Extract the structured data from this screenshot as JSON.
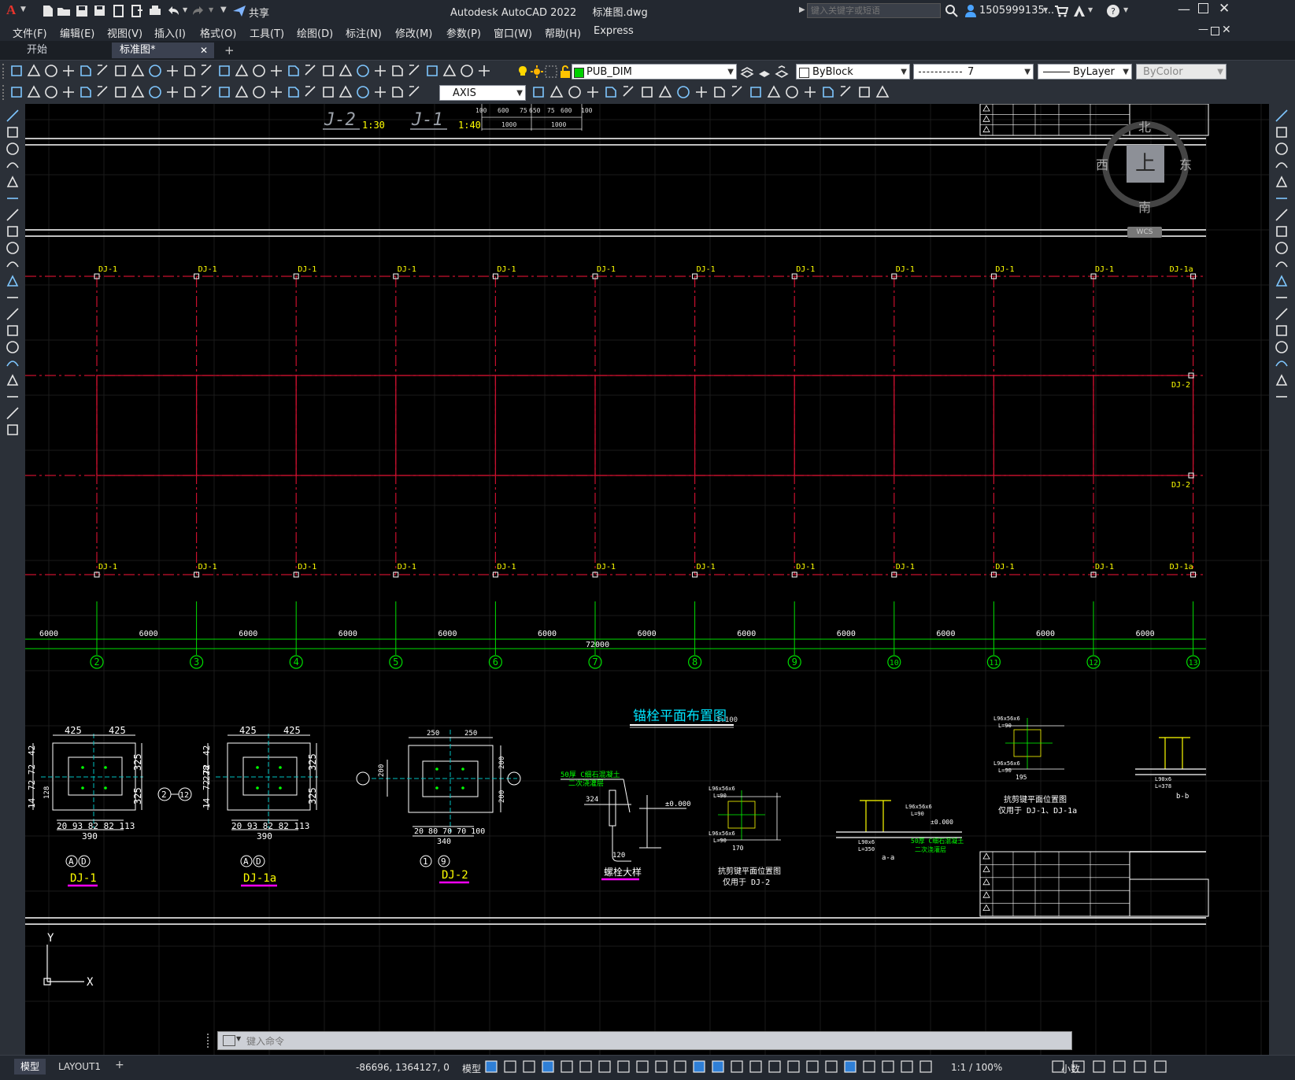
{
  "titlebar": {
    "app_title": "Autodesk AutoCAD 2022",
    "file_name": "标准图.dwg",
    "share_label": "共享",
    "search_placeholder": "键入关键字或短语",
    "user_name": "1505999135...",
    "logo_letter": "A"
  },
  "menu": {
    "items": [
      "文件(F)",
      "编辑(E)",
      "视图(V)",
      "插入(I)",
      "格式(O)",
      "工具(T)",
      "绘图(D)",
      "标注(N)",
      "修改(M)",
      "参数(P)",
      "窗口(W)",
      "帮助(H)",
      "Express"
    ]
  },
  "tabs": {
    "start_label": "开始",
    "active_label": "标准图*",
    "close_glyph": "✕",
    "add_glyph": "+"
  },
  "toolbar": {
    "layer_name": "PUB_DIM",
    "color_value": "ByBlock",
    "linetype_value": "7",
    "lineweight_value": "ByLayer",
    "plotstyle_value": "ByColor",
    "dimstyle_value": "AXIS"
  },
  "viewcube": {
    "north": "北",
    "south": "南",
    "east": "东",
    "west": "西",
    "face": "上",
    "wcs_label": "WCS"
  },
  "drawing": {
    "top_labels": {
      "j2": "J-2",
      "j2_scale": "1:30",
      "j1": "J-1",
      "j1_scale": "1:40"
    },
    "top_dims": [
      "100",
      "600",
      "75",
      "650",
      "75",
      "600",
      "100",
      "1000",
      "1000"
    ],
    "dj_tags_top": [
      "DJ-1",
      "DJ-1",
      "DJ-1",
      "DJ-1",
      "DJ-1",
      "DJ-1",
      "DJ-1",
      "DJ-1",
      "DJ-1",
      "DJ-1",
      "DJ-1",
      "DJ-1a"
    ],
    "dj_tags_bottom": [
      "DJ-1",
      "DJ-1",
      "DJ-1",
      "DJ-1",
      "DJ-1",
      "DJ-1",
      "DJ-1",
      "DJ-1",
      "DJ-1",
      "DJ-1",
      "DJ-1",
      "DJ-1a"
    ],
    "dj_tags_side": [
      "DJ-2",
      "DJ-2"
    ],
    "span_dims": [
      "6000",
      "6000",
      "6000",
      "6000",
      "6000",
      "6000",
      "6000",
      "6000",
      "6000",
      "6000",
      "6000",
      "6000"
    ],
    "total_dim": "72000",
    "axis_numbers": [
      "2",
      "3",
      "4",
      "5",
      "6",
      "7",
      "8",
      "9",
      "10",
      "11",
      "12",
      "13"
    ],
    "plan_title": "锚栓平面布置图",
    "plan_scale": "1:100",
    "details": {
      "dj1_label": "DJ-1",
      "dj1a_label": "DJ-1a",
      "dj2_label": "DJ-2",
      "bolt_label": "螺栓大样",
      "dim_425": "425",
      "dim_325": "325",
      "dim_390": "390",
      "dim_row": "20 93 82 82 113",
      "dim_left1": "42",
      "dim_left2": "72 72",
      "dim_left3": "128",
      "dim_left4": "14",
      "dim_228": "228",
      "axis_ad_a": "A",
      "axis_ad_d": "D",
      "axis_2": "2",
      "axis_12": "12",
      "dim_250": "250",
      "dim_200": "200",
      "dim_340": "340",
      "dim_row2": "20 80 70 70 100",
      "axis_1": "1",
      "axis_9": "9",
      "grout_note": "50厚 C细石混凝土",
      "grout_note2": "二次浇灌层",
      "dim_324": "324",
      "dim_120": "120",
      "elev": "±0.000",
      "shear_key_title": "抗剪键平面位置图",
      "shear_key_sub": "仅用于 DJ-2",
      "shear_key_title2": "抗剪键平面位置图",
      "shear_key_sub2": "仅用于 DJ-1、DJ-1a",
      "angle_label": "L96x56x6",
      "angle_len": "L=90",
      "angle_label2": "L90x6",
      "angle_len2": "L=350",
      "section_aa": "a-a",
      "section_bb": "b-b",
      "dims_170": "170",
      "dims_195": "195",
      "dim_378": "L=378"
    },
    "ucs_x": "X",
    "ucs_y": "Y"
  },
  "command": {
    "placeholder": "键入命令"
  },
  "layout_tabs": [
    "模型",
    "LAYOUT1"
  ],
  "status": {
    "coords": "-86696, 1364127, 0",
    "space": "模型",
    "scale": "1:1 / 100%",
    "units": "小数"
  },
  "colors": {
    "axis_red": "#c8102e",
    "dim_green": "#00e000",
    "tag_yellow": "#ffff00",
    "title_cyan": "#00e5ff",
    "magenta": "#ff00ff",
    "white": "#ffffff"
  }
}
